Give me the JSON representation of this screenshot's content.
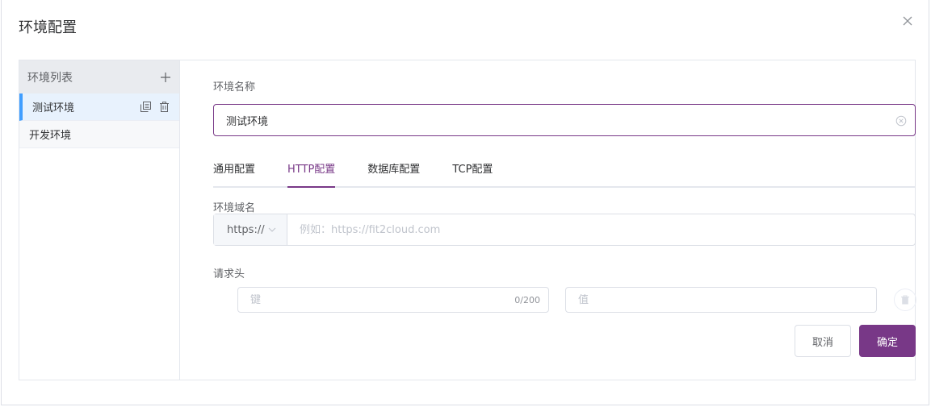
{
  "dialog": {
    "title": "环境配置"
  },
  "env_list": {
    "header": "环境列表",
    "items": [
      {
        "label": "测试环境",
        "active": true
      },
      {
        "label": "开发环境",
        "active": false
      }
    ]
  },
  "form": {
    "name_label": "环境名称",
    "name_value": "测试环境",
    "tabs": [
      {
        "label": "通用配置",
        "active": false
      },
      {
        "label": "HTTP配置",
        "active": true
      },
      {
        "label": "数据库配置",
        "active": false
      },
      {
        "label": "TCP配置",
        "active": false
      }
    ],
    "domain_label": "环境域名",
    "protocol": "https://",
    "domain_placeholder": "例如：https://fit2cloud.com",
    "headers_label": "请求头",
    "key_placeholder": "键",
    "key_counter": "0/200",
    "value_placeholder": "值"
  },
  "buttons": {
    "cancel": "取消",
    "confirm": "确定"
  },
  "colors": {
    "accent": "#783887",
    "active_item_bar": "#409eff"
  }
}
